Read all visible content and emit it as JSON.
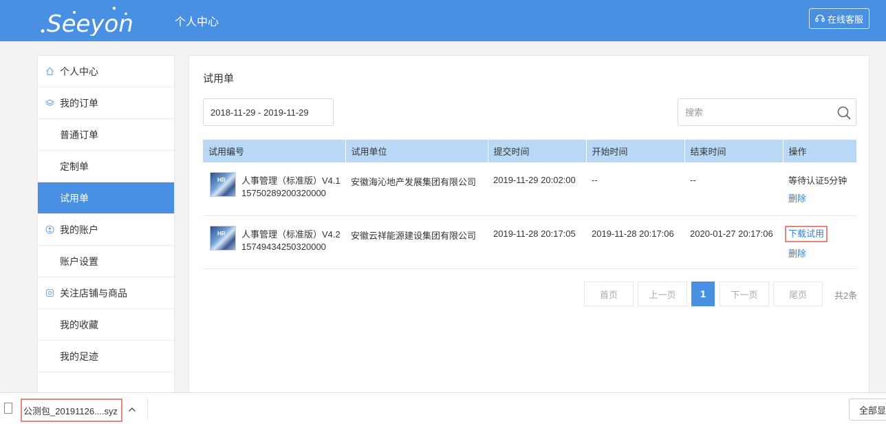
{
  "header": {
    "logo_text": "Seeyon",
    "title": "个人中心",
    "service_label": "在线客服",
    "bg_color": "#4a90e2"
  },
  "sidebar": {
    "items": [
      {
        "label": "个人中心",
        "type": "group",
        "icon": "home-icon"
      },
      {
        "label": "我的订单",
        "type": "group",
        "icon": "layers-icon"
      },
      {
        "label": "普通订单",
        "type": "sub"
      },
      {
        "label": "定制单",
        "type": "sub"
      },
      {
        "label": "试用单",
        "type": "sub",
        "active": true
      },
      {
        "label": "我的账户",
        "type": "group",
        "icon": "user-circle-icon"
      },
      {
        "label": "账户设置",
        "type": "sub"
      },
      {
        "label": "关注店铺与商品",
        "type": "group",
        "icon": "camera-icon"
      },
      {
        "label": "我的收藏",
        "type": "sub"
      },
      {
        "label": "我的足迹",
        "type": "sub"
      }
    ]
  },
  "main": {
    "title": "试用单",
    "date_range": "2018-11-29 - 2019-11-29",
    "search_placeholder": "搜索",
    "columns": [
      "试用编号",
      "试用单位",
      "提交时间",
      "开始时间",
      "结束时间",
      "操作"
    ],
    "rows": [
      {
        "product": "人事管理（标准版）V4.1",
        "code": "15750289200320000",
        "unit": "安徽海沁地产发展集团有限公司",
        "submit": "2019-11-29 20:02:00",
        "start": "--",
        "end": "--",
        "status": "等待认证5分钟",
        "delete": "删除"
      },
      {
        "product": "人事管理（标准版）V4.2",
        "code": "15749434250320000",
        "unit": "安徽云祥能源建设集团有限公司",
        "submit": "2019-11-28 20:17:05",
        "start": "2019-11-28 20:17:06",
        "end": "2020-01-27 20:17:06",
        "download": "下载试用",
        "delete": "删除"
      }
    ],
    "thumb_label": "HR"
  },
  "pagination": {
    "first": "首页",
    "prev": "上一页",
    "current": "1",
    "next": "下一页",
    "last": "尾页",
    "total": "共2条"
  },
  "download_bar": {
    "file_name": "公测包_20191126....syz",
    "show_all": "全部显示"
  }
}
